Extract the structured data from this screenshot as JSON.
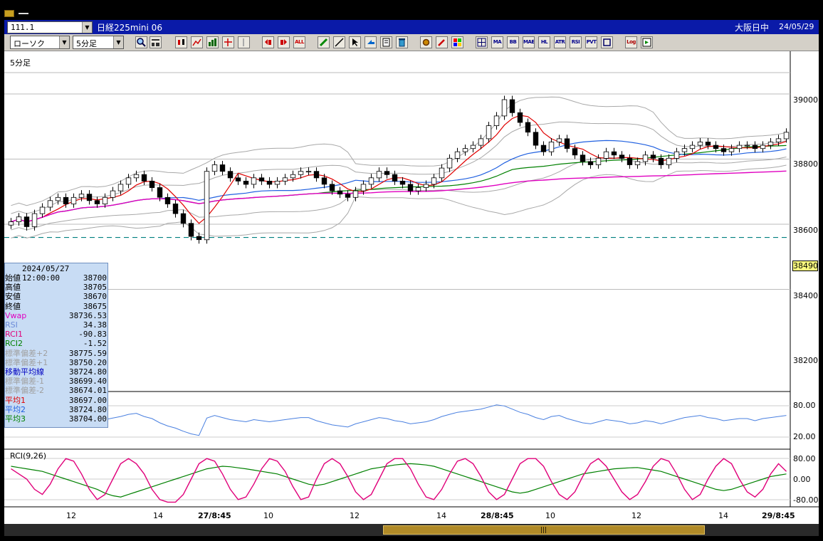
{
  "header": {
    "code": "111.1",
    "product": "日経225mini 06",
    "session": "大阪日中",
    "date": "24/05/29"
  },
  "toolbar": {
    "chart_type": "ローソク",
    "period": "5分足",
    "text_buttons": [
      "ALL",
      "MA",
      "BB",
      "MAE",
      "HL",
      "ATR",
      "RSI",
      "PVT",
      "Log"
    ]
  },
  "panel": {
    "period_label": "5分足",
    "rci_label": "RCI(9,26)"
  },
  "price_axis": {
    "ticks": [
      "39000",
      "38800",
      "38600",
      "38400",
      "38200"
    ],
    "current_price": "38490"
  },
  "rsi_axis": {
    "ticks": [
      "80.00",
      "20.00"
    ]
  },
  "rci_axis": {
    "ticks": [
      "80.00",
      "0.00",
      "-80.00"
    ]
  },
  "time_axis": {
    "labels": [
      {
        "text": "12",
        "bold": false
      },
      {
        "text": "14",
        "bold": false
      },
      {
        "text": "27/8:45",
        "bold": true
      },
      {
        "text": "10",
        "bold": false
      },
      {
        "text": "12",
        "bold": false
      },
      {
        "text": "14",
        "bold": false
      },
      {
        "text": "28/8:45",
        "bold": true
      },
      {
        "text": "10",
        "bold": false
      },
      {
        "text": "12",
        "bold": false
      },
      {
        "text": "14",
        "bold": false
      },
      {
        "text": "29/8:45",
        "bold": true
      }
    ]
  },
  "info": {
    "datetime": "2024/05/27  12:00:00",
    "rows": [
      {
        "label": "始値",
        "value": "38700",
        "color": "#000000"
      },
      {
        "label": "高値",
        "value": "38705",
        "color": "#000000"
      },
      {
        "label": "安値",
        "value": "38670",
        "color": "#000000"
      },
      {
        "label": "終値",
        "value": "38675",
        "color": "#000000"
      },
      {
        "label": "Vwap",
        "value": "38736.53",
        "color": "#e000c0"
      },
      {
        "label": "RSI",
        "value": "34.38",
        "color": "#6a8ad8"
      },
      {
        "label": "RCI1",
        "value": "-90.83",
        "color": "#e0007a"
      },
      {
        "label": "RCI2",
        "value": "-1.52",
        "color": "#008000"
      },
      {
        "label": "標準偏差+2",
        "value": "38775.59",
        "color": "#a0a0a0"
      },
      {
        "label": "標準偏差+1",
        "value": "38750.20",
        "color": "#a0a0a0"
      },
      {
        "label": "移動平均線",
        "value": "38724.80",
        "color": "#0000c0"
      },
      {
        "label": "標準偏差-1",
        "value": "38699.40",
        "color": "#a0a0a0"
      },
      {
        "label": "標準偏差-2",
        "value": "38674.01",
        "color": "#a0a0a0"
      },
      {
        "label": "平均1",
        "value": "38697.00",
        "color": "#e00000"
      },
      {
        "label": "平均2",
        "value": "38724.80",
        "color": "#2060e0"
      },
      {
        "label": "平均3",
        "value": "38704.00",
        "color": "#008000"
      }
    ]
  },
  "colors": {
    "candle_up": "#ffffff",
    "candle_down": "#000000",
    "vwap": "#e000c0",
    "ma_short": "#e00000",
    "ma_mid": "#2060e0",
    "ma_long": "#008000",
    "bands": "#a8a8a8",
    "rsi": "#4a80e0",
    "rci_short": "#e0007a",
    "rci_long": "#008000",
    "ref_line": "#008080"
  },
  "chart_data": {
    "type": "line",
    "price_range": [
      38200,
      39000
    ],
    "reference_price": 38590,
    "close": [
      38625,
      38640,
      38610,
      38650,
      38670,
      38690,
      38700,
      38680,
      38700,
      38710,
      38690,
      38680,
      38700,
      38720,
      38740,
      38760,
      38770,
      38750,
      38730,
      38700,
      38680,
      38650,
      38620,
      38580,
      38570,
      38780,
      38800,
      38780,
      38760,
      38750,
      38740,
      38760,
      38750,
      38740,
      38750,
      38760,
      38770,
      38780,
      38780,
      38760,
      38740,
      38720,
      38710,
      38700,
      38720,
      38740,
      38760,
      38780,
      38770,
      38750,
      38740,
      38720,
      38730,
      38740,
      38760,
      38790,
      38820,
      38840,
      38850,
      38860,
      38880,
      38920,
      38950,
      39000,
      38960,
      38930,
      38900,
      38860,
      38840,
      38870,
      38880,
      38850,
      38830,
      38810,
      38800,
      38820,
      38840,
      38830,
      38820,
      38800,
      38810,
      38830,
      38820,
      38800,
      38820,
      38840,
      38850,
      38860,
      38870,
      38860,
      38850,
      38840,
      38850,
      38860,
      38860,
      38850,
      38860,
      38870,
      38880,
      38900
    ],
    "rsi": [
      42,
      45,
      40,
      44,
      48,
      52,
      55,
      50,
      53,
      56,
      50,
      48,
      52,
      55,
      58,
      62,
      64,
      58,
      54,
      46,
      40,
      36,
      30,
      25,
      22,
      55,
      60,
      56,
      52,
      50,
      48,
      52,
      50,
      48,
      50,
      52,
      54,
      56,
      56,
      50,
      46,
      42,
      40,
      38,
      44,
      48,
      52,
      56,
      54,
      50,
      48,
      44,
      46,
      48,
      52,
      58,
      62,
      66,
      68,
      70,
      72,
      76,
      80,
      78,
      72,
      66,
      62,
      56,
      52,
      58,
      60,
      54,
      50,
      46,
      44,
      48,
      52,
      50,
      48,
      44,
      46,
      50,
      48,
      44,
      48,
      52,
      56,
      58,
      60,
      56,
      54,
      50,
      52,
      54,
      54,
      50,
      54,
      56,
      58,
      60
    ],
    "rci_short": [
      40,
      20,
      0,
      -40,
      -60,
      -20,
      40,
      80,
      70,
      20,
      -40,
      -80,
      -60,
      0,
      60,
      80,
      60,
      20,
      -40,
      -80,
      -90,
      -90,
      -60,
      0,
      60,
      80,
      70,
      20,
      -40,
      -80,
      -70,
      -20,
      40,
      80,
      70,
      30,
      -30,
      -80,
      -70,
      0,
      60,
      80,
      60,
      10,
      -50,
      -80,
      -60,
      0,
      60,
      80,
      80,
      40,
      -20,
      -70,
      -80,
      -40,
      20,
      70,
      80,
      60,
      10,
      -50,
      -80,
      -60,
      0,
      60,
      80,
      80,
      50,
      -10,
      -60,
      -80,
      -50,
      10,
      60,
      80,
      50,
      0,
      -50,
      -80,
      -60,
      -10,
      50,
      80,
      70,
      20,
      -40,
      -80,
      -60,
      0,
      50,
      80,
      60,
      0,
      -50,
      -70,
      -40,
      20,
      60,
      30
    ],
    "rci_long": [
      50,
      45,
      40,
      35,
      30,
      20,
      10,
      0,
      -10,
      -20,
      -30,
      -40,
      -55,
      -65,
      -70,
      -60,
      -50,
      -40,
      -30,
      -20,
      -10,
      0,
      10,
      20,
      30,
      40,
      45,
      50,
      48,
      44,
      40,
      35,
      30,
      25,
      20,
      10,
      0,
      -10,
      -20,
      -25,
      -20,
      -10,
      0,
      10,
      20,
      30,
      40,
      45,
      50,
      55,
      58,
      60,
      58,
      55,
      50,
      40,
      30,
      20,
      10,
      0,
      -10,
      -20,
      -30,
      -40,
      -50,
      -55,
      -50,
      -40,
      -30,
      -20,
      -10,
      0,
      10,
      20,
      25,
      30,
      35,
      40,
      42,
      44,
      45,
      40,
      35,
      30,
      20,
      10,
      0,
      -10,
      -20,
      -30,
      -40,
      -45,
      -40,
      -30,
      -20,
      -10,
      0,
      10,
      15,
      20
    ]
  }
}
